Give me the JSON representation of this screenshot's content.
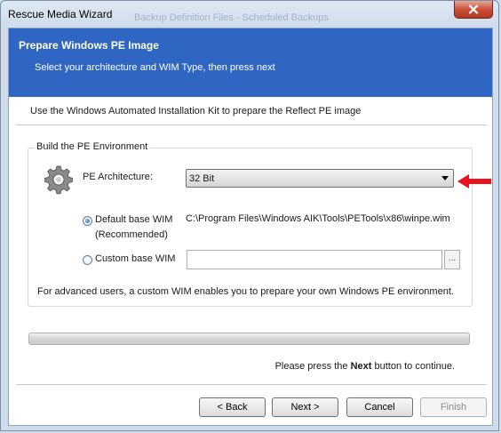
{
  "window": {
    "title": "Rescue Media Wizard",
    "background_text": "Backup Definition Files - Scheduled Backups"
  },
  "banner": {
    "title": "Prepare Windows PE Image",
    "subtitle": "Select your architecture and WIM Type, then press next"
  },
  "intro_text": "Use the Windows Automated Installation Kit to prepare the Reflect PE image",
  "group": {
    "legend": "Build the PE Environment",
    "architecture_label": "PE Architecture:",
    "architecture_value": "32 Bit",
    "default_wim_label_line1": "Default base WIM",
    "default_wim_label_line2": "(Recommended)",
    "default_wim_path": "C:\\Program Files\\Windows AIK\\Tools\\PETools\\x86\\winpe.wim",
    "default_wim_selected": true,
    "custom_wim_label": "Custom base WIM",
    "custom_wim_value": "",
    "browse_label": "...",
    "advanced_note": "For advanced users, a custom WIM enables you to prepare your own Windows PE environment."
  },
  "progress": 0,
  "continue_prefix": "Please press the ",
  "continue_bold": "Next",
  "continue_suffix": " button to continue.",
  "buttons": {
    "back": "< Back",
    "next": "Next >",
    "cancel": "Cancel",
    "finish": "Finish"
  },
  "icons": {
    "close": "close-icon",
    "gear": "gear-icon",
    "dropdown": "chevron-down-icon",
    "pointer": "red-arrow-icon"
  },
  "colors": {
    "banner": "#2f66c4",
    "close_button": "#c84b34",
    "pointer_arrow": "#e8141c"
  }
}
